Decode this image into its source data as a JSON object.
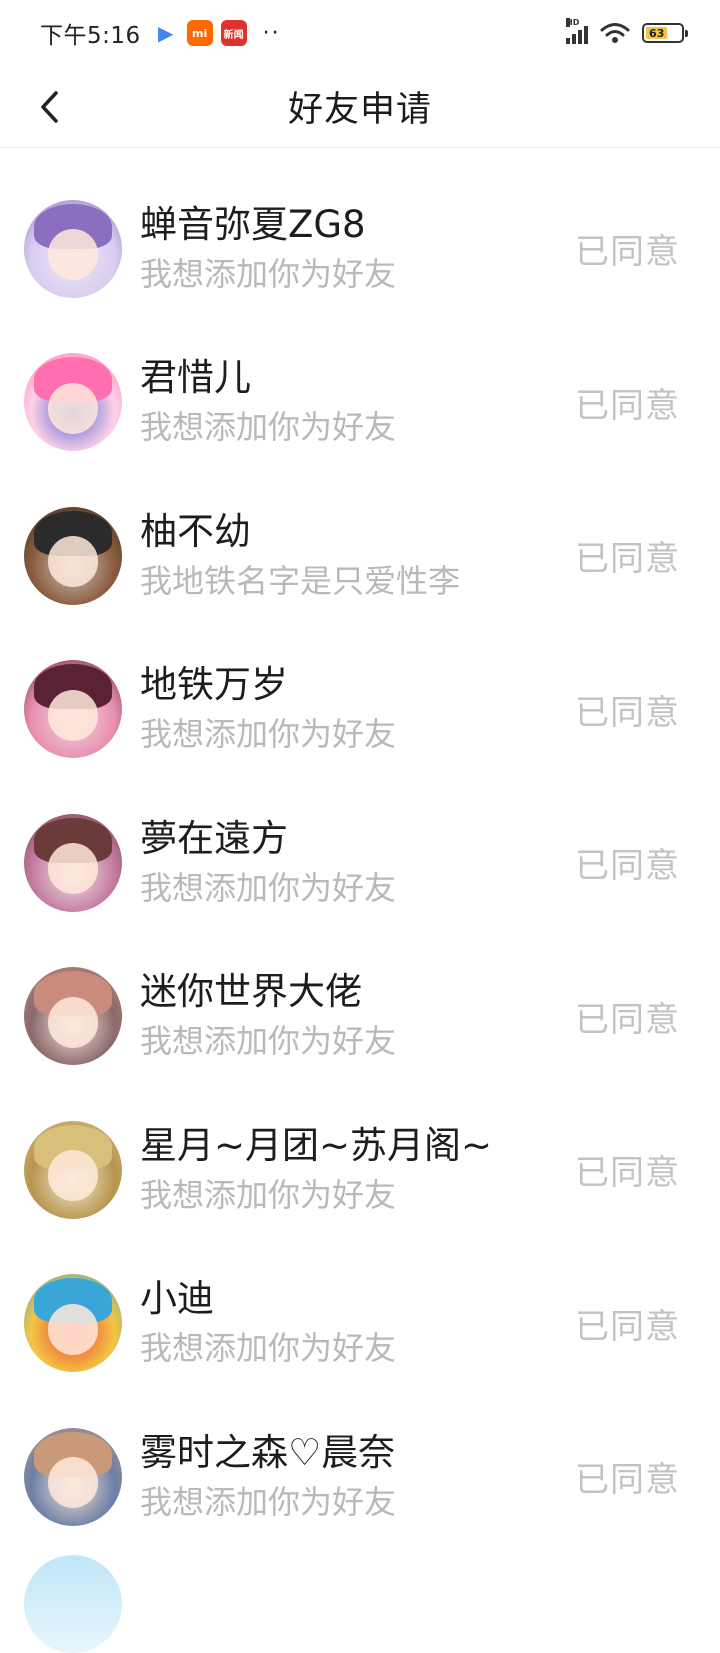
{
  "status_bar": {
    "time": "下午5:16",
    "app_icons": [
      {
        "icon": "play-store-icon",
        "label": "▶"
      },
      {
        "icon": "mi-app-icon",
        "label": "mi"
      },
      {
        "icon": "news-app-icon",
        "label": "新闻"
      }
    ],
    "network": "HD",
    "battery_level": "63"
  },
  "nav": {
    "title": "好友申请",
    "back_icon": "chevron-left-icon"
  },
  "requests": [
    {
      "name": "蝉音弥夏ZG8",
      "message": "我想添加你为好友",
      "status": "已同意",
      "avatar_colors": [
        "#8a6fc1",
        "#efe7f7",
        "#d9cdef"
      ]
    },
    {
      "name": "君惜儿",
      "message": "我想添加你为好友",
      "status": "已同意",
      "avatar_colors": [
        "#ff6fb0",
        "#4a63d8",
        "#ffd1e6"
      ]
    },
    {
      "name": "柚不幼",
      "message": "我地铁名字是只爱性李",
      "status": "已同意",
      "avatar_colors": [
        "#2b2b2b",
        "#c9c3be",
        "#8a5a3c"
      ]
    },
    {
      "name": "地铁万岁",
      "message": "我想添加你为好友",
      "status": "已同意",
      "avatar_colors": [
        "#5a2236",
        "#f3d6de",
        "#e98eb0"
      ]
    },
    {
      "name": "夢在遠方",
      "message": "我想添加你为好友",
      "status": "已同意",
      "avatar_colors": [
        "#6b3a3a",
        "#f7e3e3",
        "#c27aa0"
      ]
    },
    {
      "name": "迷你世界大佬",
      "message": "我想添加你为好友",
      "status": "已同意",
      "avatar_colors": [
        "#c98b7e",
        "#f4e6e2",
        "#8b6a6a"
      ]
    },
    {
      "name": "星月~月团~苏月阁~",
      "message": "我想添加你为好友",
      "status": "已同意",
      "avatar_colors": [
        "#d9c07a",
        "#f5ecd0",
        "#b89550"
      ]
    },
    {
      "name": "小迪",
      "message": "我想添加你为好友",
      "status": "已同意",
      "avatar_colors": [
        "#3aa6d8",
        "#e8453c",
        "#f4c542"
      ]
    },
    {
      "name": "雾时之森♡晨奈",
      "message": "我想添加你为好友",
      "status": "已同意",
      "avatar_colors": [
        "#c99a7a",
        "#f4e4da",
        "#6d7fa6"
      ]
    }
  ]
}
